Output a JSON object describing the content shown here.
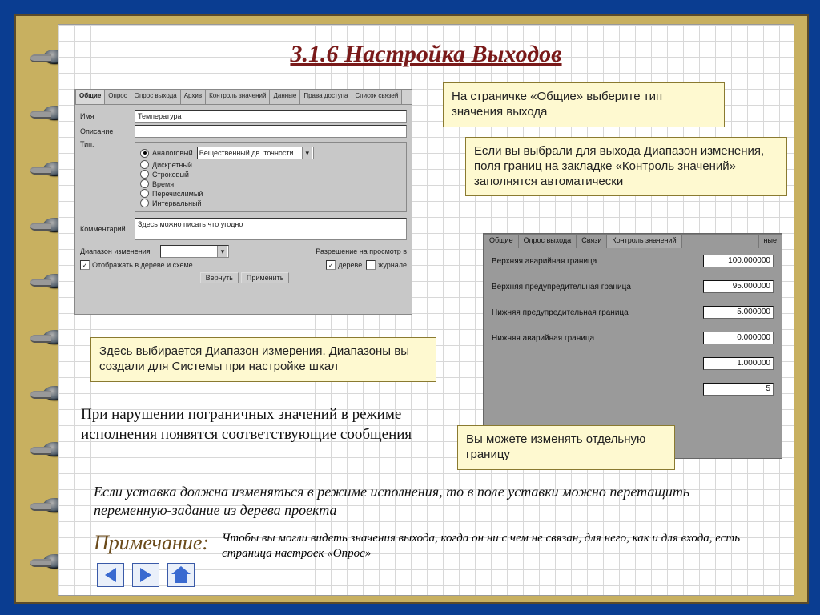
{
  "title": "3.1.6 Настройка Выходов",
  "panel1": {
    "tabs": [
      "Общие",
      "Опрос",
      "Опрос выхода",
      "Архив",
      "Контроль значений",
      "Данные",
      "Права доступа",
      "Список связей"
    ],
    "active_tab": 0,
    "name_label": "Имя",
    "name_value": "Температура",
    "desc_label": "Описание",
    "desc_value": "",
    "type_label": "Тип:",
    "types": [
      "Аналоговый",
      "Дискретный",
      "Строковый",
      "Время",
      "Перечислимый",
      "Интервальный"
    ],
    "type_selected": 0,
    "subtype_dd": "Вещественный дв. точности",
    "comment_label": "Комментарий",
    "comment_value": "Здесь можно писать что угодно",
    "range_label": "Диапазон изменения",
    "perm_label": "Разрешение на просмотр в",
    "perm_opts": [
      "дереве",
      "журнале"
    ],
    "show_chk": "Отображать в дереве и схеме",
    "btn_back": "Вернуть",
    "btn_apply": "Применить"
  },
  "panel2": {
    "tabs": [
      "Общие",
      "Опрос выхода",
      "Связи",
      "Контроль значений",
      "...",
      "ные"
    ],
    "active_tab": 3,
    "rows": [
      {
        "label": "Верхняя аварийная граница",
        "value": "100.000000"
      },
      {
        "label": "Верхняя предупредительная граница",
        "value": "95.000000"
      },
      {
        "label": "Нижняя предупредительная граница",
        "value": "5.000000"
      },
      {
        "label": "Нижняя аварийная граница",
        "value": "0.000000"
      },
      {
        "label": "",
        "value": "1.000000"
      },
      {
        "label": "",
        "value": "5"
      }
    ]
  },
  "callouts": {
    "c1": "На страничке «Общие» выберите тип значения выхода",
    "c2": "Если вы выбрали для выхода Диапазон изменения, поля границ на закладке «Контроль значений» заполнятся автоматически",
    "c3": "Здесь выбирается Диапазон измерения. Диапазоны вы создали для Системы при настройке шкал",
    "c4": "Вы можете изменять отдельную границу"
  },
  "body1": "При нарушении пограничных значений в режиме исполнения появятся соответствующие сообщения",
  "body2": "Если уставка должна изменяться в режиме исполнения, то в поле уставки можно перетащить переменную-задание из дерева проекта",
  "note_label": "Примечание:",
  "note_text": "Чтобы вы могли видеть значения выхода, когда он ни с чем не связан, для него, как и для входа, есть страница настроек «Опрос»"
}
